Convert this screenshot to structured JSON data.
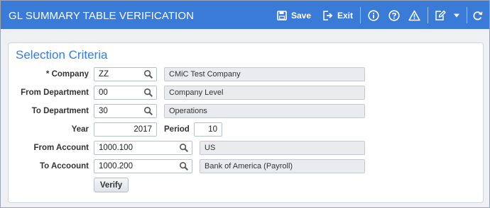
{
  "window": {
    "title": "GL SUMMARY TABLE VERIFICATION"
  },
  "toolbar": {
    "save_label": "Save",
    "exit_label": "Exit",
    "icons": [
      "save-icon",
      "exit-icon",
      "info-icon",
      "help-icon",
      "warning-icon",
      "edit-icon",
      "dropdown-icon",
      "refresh-icon"
    ]
  },
  "panel": {
    "title": "Selection Criteria"
  },
  "form": {
    "company": {
      "required_mark": "*",
      "label": "Company",
      "value": "ZZ",
      "description": "CMiC Test Company"
    },
    "from_department": {
      "label": "From Department",
      "value": "00",
      "description": "Company Level"
    },
    "to_department": {
      "label": "To Department",
      "value": "30",
      "description": "Operations"
    },
    "year": {
      "label": "Year",
      "value": "2017"
    },
    "period": {
      "label": "Period",
      "value": "10"
    },
    "from_account": {
      "label": "From Account",
      "value": "1000.100",
      "description": "US"
    },
    "to_account": {
      "label": "To Accoount",
      "value": "1000.200",
      "description": "Bank of America (Payroll)"
    },
    "verify_label": "Verify"
  },
  "colors": {
    "titlebar": "#3a7bd8",
    "panel_title": "#3a7bd8",
    "readonly_bg": "#e9ebee"
  }
}
